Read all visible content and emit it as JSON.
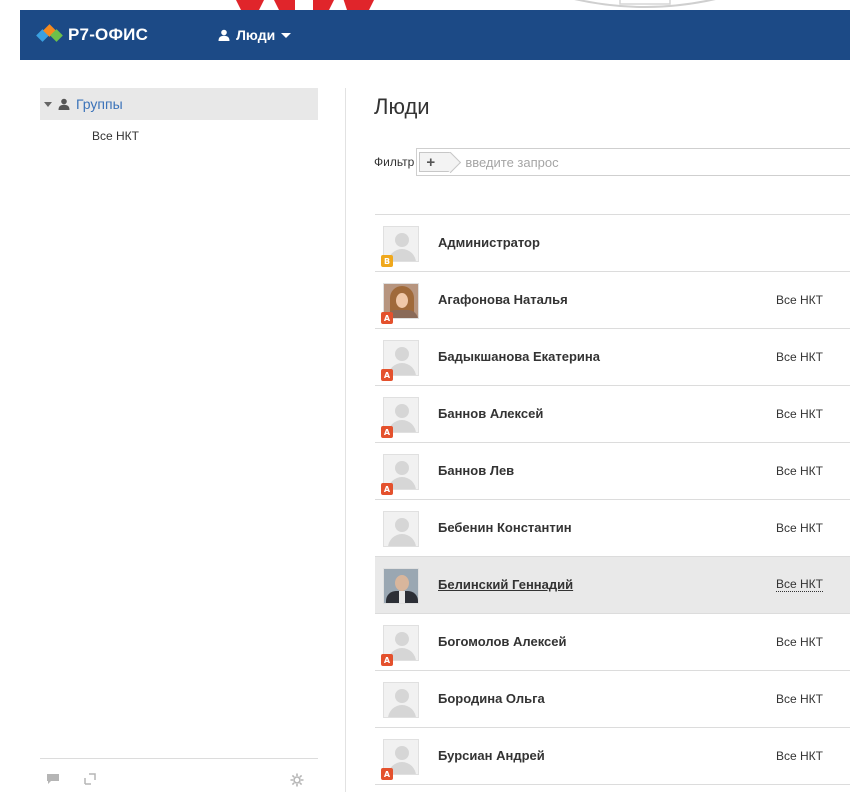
{
  "header": {
    "logo_text": "Р7-ОФИС",
    "module_label": "Люди",
    "colors": {
      "bar": "#1c4a86",
      "logo_orange": "#f58a1f",
      "logo_blue": "#3aa0e0",
      "logo_green": "#6dc04a"
    }
  },
  "sidebar": {
    "root_label": "Группы",
    "children": [
      "Все НКТ"
    ]
  },
  "main": {
    "title": "Люди",
    "filter_label": "Фильтр",
    "filter_placeholder": "введите запрос",
    "people": [
      {
        "name": "Администратор",
        "dept": "",
        "avatar": "placeholder",
        "badge": "admin"
      },
      {
        "name": "Агафонова Наталья",
        "dept": "Все НКТ",
        "avatar": "photo-female",
        "badge": "user"
      },
      {
        "name": "Бадыкшанова Екатерина",
        "dept": "Все НКТ",
        "avatar": "placeholder",
        "badge": "user"
      },
      {
        "name": "Баннов Алексей",
        "dept": "Все НКТ",
        "avatar": "placeholder",
        "badge": "user"
      },
      {
        "name": "Баннов Лев",
        "dept": "Все НКТ",
        "avatar": "placeholder",
        "badge": "user"
      },
      {
        "name": "Бебенин Константин",
        "dept": "Все НКТ",
        "avatar": "placeholder",
        "badge": ""
      },
      {
        "name": "Белинский Геннадий",
        "dept": "Все НКТ",
        "avatar": "photo-male",
        "badge": "",
        "selected": true
      },
      {
        "name": "Богомолов Алексей",
        "dept": "Все НКТ",
        "avatar": "placeholder",
        "badge": "user"
      },
      {
        "name": "Бородина Ольга",
        "dept": "Все НКТ",
        "avatar": "placeholder",
        "badge": ""
      },
      {
        "name": "Бурсиан Андрей",
        "dept": "Все НКТ",
        "avatar": "placeholder",
        "badge": "user"
      }
    ]
  },
  "footer_icons": [
    "chat-icon",
    "expand-icon",
    "settings-icon"
  ]
}
